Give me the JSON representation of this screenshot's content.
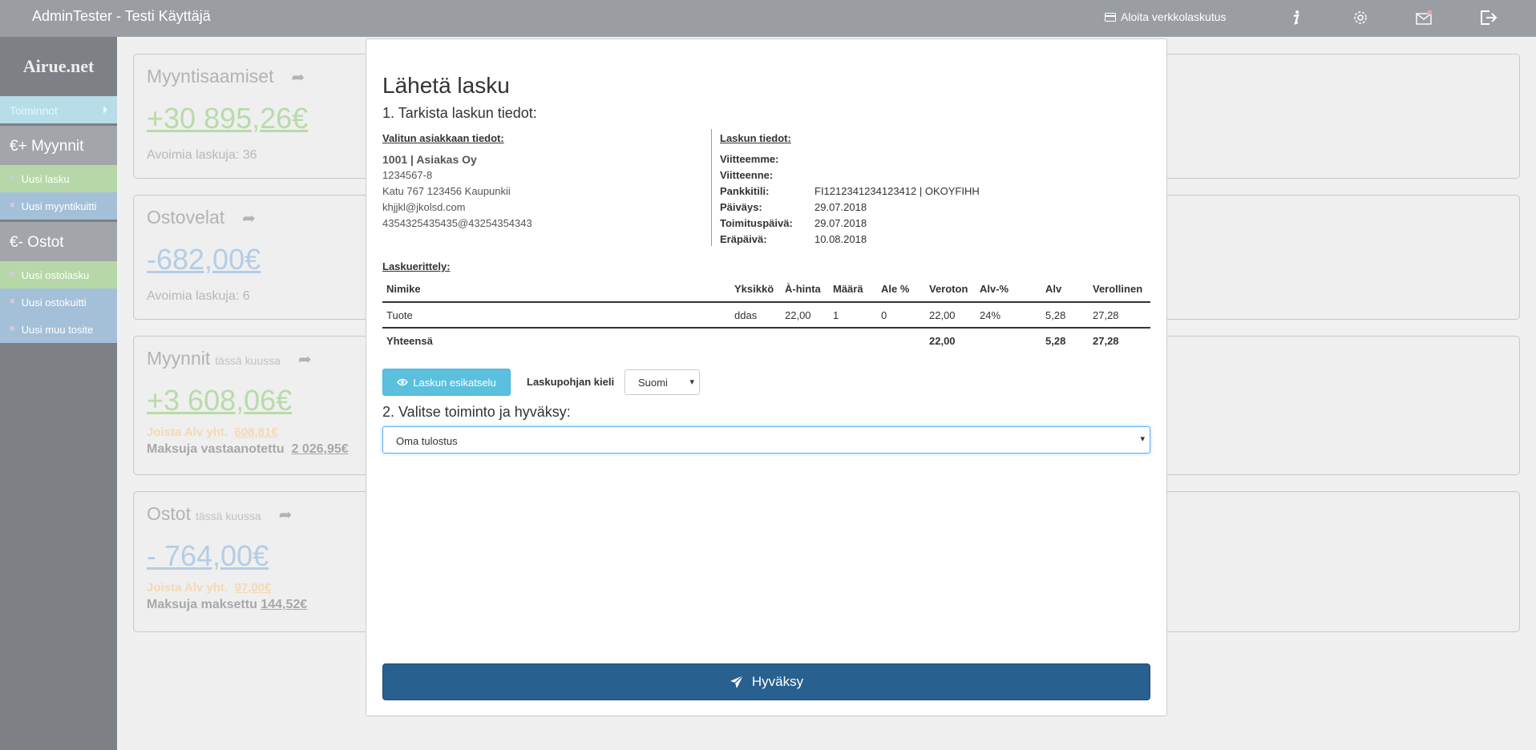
{
  "topbar": {
    "title": "AdminTester - Testi Käyttäjä",
    "ebill_label": "Aloita verkkolaskutus",
    "icons": [
      "credit-card-icon",
      "info-icon",
      "gear-icon",
      "mail-icon",
      "logout-icon"
    ]
  },
  "sidebar": {
    "logo": "Airue.net",
    "toiminnot": "Toiminnot",
    "sales_header": "€+  Myynnit",
    "sales_items": [
      "Uusi lasku",
      "Uusi myyntikuitti"
    ],
    "purchases_header": "€-  Ostot",
    "purchase_items": [
      "Uusi ostolasku",
      "Uusi ostokuitti",
      "Uusi muu tosite"
    ]
  },
  "cards": {
    "receivables": {
      "title": "Myyntisaamiset",
      "amount": "+30 895,26€",
      "info": "Avoimia laskuja: 36"
    },
    "payables": {
      "title": "Ostovelat",
      "amount": "-682,00€",
      "info": "Avoimia laskuja: 6"
    },
    "sales_month": {
      "title": "Myynnit",
      "sub": "tässä kuussa",
      "amount": "+3 608,06€",
      "vat_label": "Joista Alv yht.",
      "vat_value": "608,81€",
      "paid_label": "Maksuja vastaanotettu",
      "paid_value": "2 026,95€"
    },
    "purchases_month": {
      "title": "Ostot",
      "sub": "tässä kuussa",
      "amount": "- 764,00€",
      "vat_label": "Joista Alv yht.",
      "vat_value": "97,00€",
      "paid_label": "Maksuja maksettu",
      "paid_value": "144,52€"
    }
  },
  "modal": {
    "title": "Lähetä lasku",
    "step1": "1. Tarkista laskun tiedot:",
    "customer": {
      "header": "Valitun asiakkaan tiedot:",
      "name": "1001 | Asiakas Oy",
      "business_id": "1234567-8",
      "address": "Katu 767 123456 Kaupunkii",
      "email": "khjjkl@jkolsd.com",
      "einvoice": "4354325435435@43254354343"
    },
    "invoice": {
      "header": "Laskun tiedot:",
      "our_ref_label": "Viitteemme:",
      "your_ref_label": "Viitteenne:",
      "bank_label": "Pankkitili:",
      "bank_value": "FI1212341234123412 | OKOYFIHH",
      "date_label": "Päiväys:",
      "date_value": "29.07.2018",
      "delivery_label": "Toimituspäivä:",
      "delivery_value": "29.07.2018",
      "due_label": "Eräpäivä:",
      "due_value": "10.08.2018"
    },
    "items_header": "Laskuerittely:",
    "table": {
      "columns": [
        "Nimike",
        "Yksikkö",
        "À-hinta",
        "Määrä",
        "Ale %",
        "Veroton",
        "Alv-%",
        "Alv",
        "Verollinen"
      ],
      "row": [
        "Tuote",
        "ddas",
        "22,00",
        "1",
        "0",
        "22,00",
        "24%",
        "5,28",
        "27,28"
      ],
      "total": [
        "Yhteensä",
        "",
        "",
        "",
        "",
        "22,00",
        "",
        "5,28",
        "27,28"
      ]
    },
    "preview_button": "Laskun esikatselu",
    "lang_label": "Laskupohjan kieli",
    "lang_value": "Suomi",
    "step2": "2. Valitse toiminto ja hyväksy:",
    "action_value": "Oma tulostus",
    "accept_button": "Hyväksy"
  }
}
